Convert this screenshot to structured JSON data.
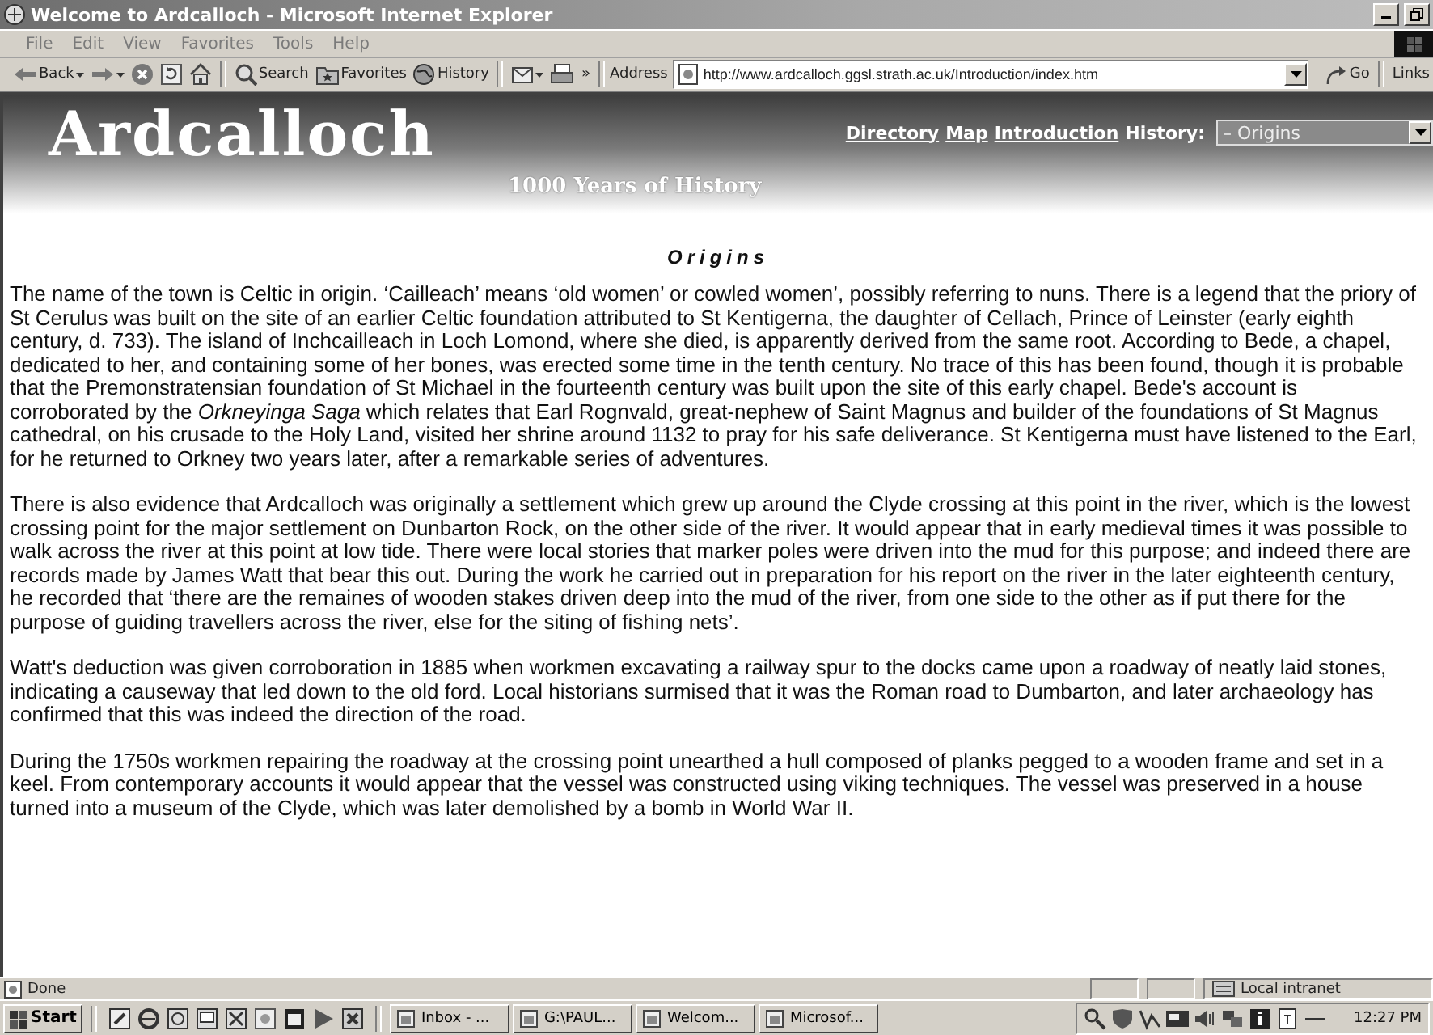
{
  "window": {
    "title": "Welcome to Ardcalloch - Microsoft Internet Explorer"
  },
  "menu": [
    "File",
    "Edit",
    "View",
    "Favorites",
    "Tools",
    "Help"
  ],
  "toolbar": {
    "buttons": [
      {
        "kind": "back",
        "label": "Back",
        "dropdown": true
      },
      {
        "kind": "forward",
        "dropdown": true
      },
      {
        "kind": "stop"
      },
      {
        "kind": "refresh"
      },
      {
        "kind": "home"
      },
      {
        "kind": "search",
        "label": "Search"
      },
      {
        "kind": "favorites",
        "label": "Favorites"
      },
      {
        "kind": "history",
        "label": "History"
      },
      {
        "kind": "mail",
        "dropdown": true
      },
      {
        "kind": "print"
      }
    ],
    "more": "»",
    "address_label": "Address",
    "url": "http://www.ardcalloch.ggsl.strath.ac.uk/Introduction/index.htm",
    "go": "Go",
    "links": "Links"
  },
  "page": {
    "logo": "Ardcalloch",
    "tagline": "1000 Years of History",
    "nav_links": [
      "Directory",
      "Map",
      "Introduction"
    ],
    "history_label": "History:",
    "history_select": "– Origins",
    "heading": "Origins",
    "paragraphs": [
      "The name of the town is Celtic in origin. ‘Cailleach’ means ‘old women’ or cowled women’, possibly referring to nuns. There is a legend that the priory of St Cerulus was built on the site of an earlier Celtic foundation attributed to St Kentigerna, the daughter of Cellach, Prince of Leinster (early eighth century, d. 733). The island of Inchcailleach in Loch Lomond, where she died, is apparently derived from the same root. According to Bede, a chapel, dedicated to her, and containing some of her bones, was erected some time in the tenth century. No trace of this has been found, though it is probable that the Premonstratensian foundation of St Michael in the fourteenth century was built upon the site of this early chapel. Bede's account is corroborated by the *Orkneyinga Saga* which relates that Earl Rognvald, great-nephew of Saint Magnus and builder of the foundations of St Magnus cathedral, on his crusade to the Holy Land, visited her shrine around 1132 to pray for his safe deliverance. St Kentigerna must have listened to the Earl, for he returned to Orkney two years later, after a remarkable series of adventures.",
      "There is also evidence that Ardcalloch was originally a settlement which grew up around the Clyde crossing at this point in the river, which is the lowest crossing point for the major settlement on Dunbarton Rock, on the other side of the river. It would appear that in early medieval times it was possible to walk across the river at this point at low tide. There were local stories that marker poles were driven into the mud for this purpose; and indeed there are records made by James Watt that bear this out. During the work he carried out in preparation for his report on the river in the later eighteenth century, he recorded that ‘there are the remaines of wooden stakes driven deep into the mud of the river, from one side to the other as if put there for the purpose of guiding travellers across the river, else for the siting of fishing nets’.",
      "Watt's deduction was given corroboration in 1885 when workmen excavating a railway spur to the docks came upon a roadway of neatly laid stones, indicating a causeway that led down to the old ford. Local historians surmised that it was the Roman road to Dumbarton, and later archaeology has confirmed that this was indeed the direction of the road.",
      "During the 1750s workmen repairing the roadway at the crossing point unearthed a hull composed of planks pegged to a wooden frame and set in a keel. From contemporary accounts it would appear that the vessel was constructed using viking techniques. The vessel was preserved in a house turned into a museum of the Clyde, which was later demolished by a bomb in World War II."
    ]
  },
  "status_bar": {
    "text": "Done",
    "zone": "Local intranet"
  },
  "taskbar": {
    "start": "Start",
    "quick_launch": [
      {
        "kind": "pen"
      },
      {
        "kind": "browser"
      },
      {
        "kind": "clock"
      },
      {
        "kind": "window"
      },
      {
        "kind": "cross"
      },
      {
        "kind": "disc"
      },
      {
        "kind": "document"
      },
      {
        "kind": "play"
      },
      {
        "kind": "expand"
      }
    ],
    "tasks": [
      "Inbox - ...",
      "G:\\PAUL...",
      "Welcom...",
      "Microsof..."
    ],
    "tray": [
      {
        "kind": "magnifier"
      },
      {
        "kind": "shield"
      },
      {
        "kind": "chart"
      },
      {
        "kind": "card"
      },
      {
        "kind": "speaker"
      },
      {
        "kind": "network"
      },
      {
        "kind": "info"
      },
      {
        "kind": "document"
      },
      {
        "kind": "line"
      }
    ],
    "clock": "12:27 PM"
  }
}
